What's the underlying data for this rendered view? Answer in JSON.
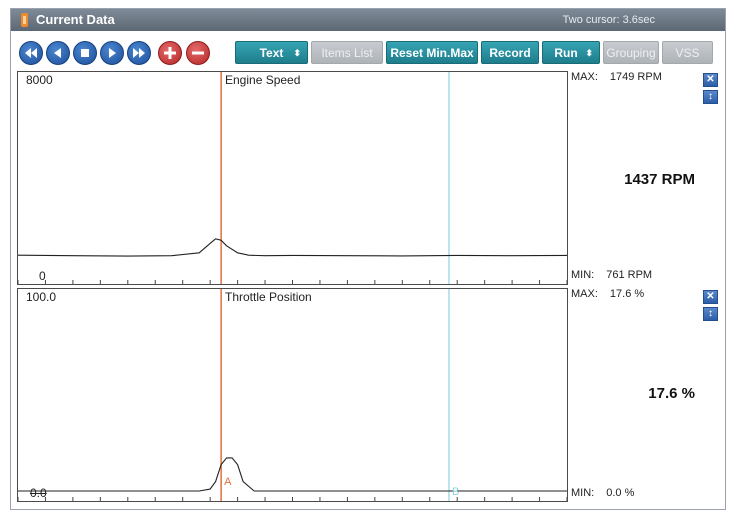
{
  "window": {
    "title": "Current Data",
    "cursor_status": "Two cursor: 3.6sec"
  },
  "toolbar": {
    "nav_icons": [
      "rewind-icon",
      "step-back-icon",
      "stop-icon",
      "play-icon",
      "fast-forward-icon",
      "zoom-in-icon",
      "zoom-out-icon"
    ],
    "text_label": "Text",
    "items_list_label": "Items List",
    "reset_label": "Reset Min.Max",
    "record_label": "Record",
    "run_label": "Run",
    "grouping_label": "Grouping",
    "vss_label": "VSS"
  },
  "graphs": [
    {
      "name": "Engine Speed",
      "ymax_label": "8000",
      "ymin_label": "0",
      "max_text": "MAX:",
      "max_value": "1749 RPM",
      "min_text": "MIN:",
      "min_value": "761 RPM",
      "current_value": "1437 RPM"
    },
    {
      "name": "Throttle Position",
      "ymax_label": "100.0",
      "ymin_label": "0.0",
      "max_text": "MAX:",
      "max_value": "17.6 %",
      "min_text": "MIN:",
      "min_value": "0.0 %",
      "current_value": "17.6 %"
    }
  ],
  "cursors": {
    "a_label": "A",
    "b_label": "B"
  },
  "colors": {
    "titlebar": "#6a7582",
    "teal_button": "#2a93a2",
    "nav_button": "#2f6ab8",
    "zoom_button": "#c93b3b",
    "cursor_a": "#e0703e",
    "cursor_b": "#8fd3e0",
    "trace": "#222222"
  },
  "chart_data": [
    {
      "type": "line",
      "title": "Engine Speed",
      "ylim": [
        0,
        8000
      ],
      "x": [
        0,
        0.1,
        0.2,
        0.28,
        0.33,
        0.35,
        0.36,
        0.37,
        0.38,
        0.4,
        0.42,
        0.45,
        0.5,
        0.6,
        0.7,
        0.8,
        0.9,
        1.0
      ],
      "series": [
        {
          "values": [
            800,
            780,
            760,
            780,
            900,
            1300,
            1500,
            1437,
            1200,
            900,
            800,
            780,
            790,
            780,
            770,
            790,
            780,
            790
          ]
        }
      ]
    },
    {
      "type": "line",
      "title": "Throttle Position",
      "ylim": [
        0,
        100
      ],
      "x": [
        0,
        0.2,
        0.33,
        0.35,
        0.36,
        0.37,
        0.38,
        0.39,
        0.4,
        0.41,
        0.43,
        0.5,
        0.7,
        1.0
      ],
      "series": [
        {
          "values": [
            0,
            0,
            0,
            1,
            5,
            14,
            17.6,
            17.6,
            14,
            5,
            0,
            0,
            0,
            0
          ]
        }
      ]
    }
  ]
}
